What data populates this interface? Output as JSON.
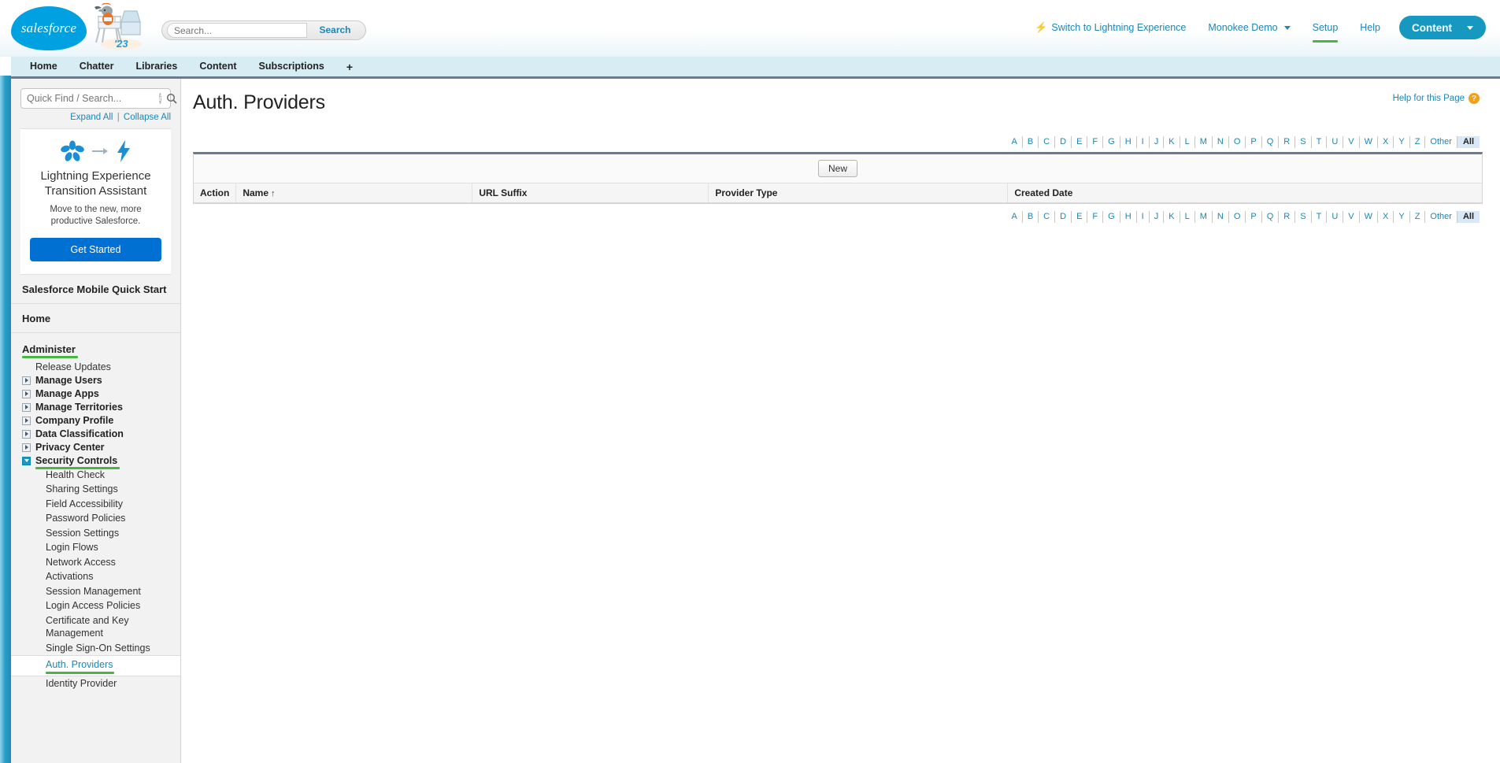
{
  "header": {
    "logo_text": "salesforce",
    "mascot_badge": "'23",
    "search": {
      "placeholder": "Search...",
      "value": "",
      "button_label": "Search"
    },
    "links": [
      {
        "label": "Switch to Lightning Experience",
        "icon": "lightning-bolt-icon",
        "active": false
      },
      {
        "label": "Monokee Demo",
        "icon": "chevron-down-icon",
        "active": false
      },
      {
        "label": "Setup",
        "active": true
      },
      {
        "label": "Help",
        "active": false
      }
    ],
    "app_button": {
      "label": "Content",
      "icon": "chevron-down-icon"
    }
  },
  "tabs": [
    {
      "label": "Home"
    },
    {
      "label": "Chatter"
    },
    {
      "label": "Libraries"
    },
    {
      "label": "Content"
    },
    {
      "label": "Subscriptions"
    },
    {
      "label": "+"
    }
  ],
  "sidebar": {
    "quick_find": {
      "placeholder": "Quick Find / Search...",
      "value": ""
    },
    "expand_all": "Expand All",
    "expand_sep": "|",
    "collapse_all": "Collapse All",
    "lex_card": {
      "title": "Lightning Experience Transition Assistant",
      "subtitle": "Move to the new, more productive Salesforce.",
      "button_label": "Get Started"
    },
    "mobile_quick_start": "Salesforce Mobile Quick Start",
    "home": "Home",
    "administer_label": "Administer",
    "nodes": [
      {
        "label": "Release Updates",
        "arrow": "none"
      },
      {
        "label": "Manage Users",
        "arrow": "collapsed"
      },
      {
        "label": "Manage Apps",
        "arrow": "collapsed"
      },
      {
        "label": "Manage Territories",
        "arrow": "collapsed"
      },
      {
        "label": "Company Profile",
        "arrow": "collapsed"
      },
      {
        "label": "Data Classification",
        "arrow": "collapsed"
      },
      {
        "label": "Privacy Center",
        "arrow": "collapsed"
      },
      {
        "label": "Security Controls",
        "arrow": "expanded",
        "underline": true
      }
    ],
    "security_children": [
      {
        "label": "Health Check",
        "selected": false
      },
      {
        "label": "Sharing Settings",
        "selected": false
      },
      {
        "label": "Field Accessibility",
        "selected": false
      },
      {
        "label": "Password Policies",
        "selected": false
      },
      {
        "label": "Session Settings",
        "selected": false
      },
      {
        "label": "Login Flows",
        "selected": false
      },
      {
        "label": "Network Access",
        "selected": false
      },
      {
        "label": "Activations",
        "selected": false
      },
      {
        "label": "Session Management",
        "selected": false
      },
      {
        "label": "Login Access Policies",
        "selected": false
      },
      {
        "label": "Certificate and Key Management",
        "selected": false
      },
      {
        "label": "Single Sign-On Settings",
        "selected": false
      },
      {
        "label": "Auth. Providers",
        "selected": true
      },
      {
        "label": "Identity Provider",
        "selected": false
      }
    ]
  },
  "main": {
    "page_title": "Auth. Providers",
    "help_link": "Help for this Page",
    "alphabet": [
      "A",
      "B",
      "C",
      "D",
      "E",
      "F",
      "G",
      "H",
      "I",
      "J",
      "K",
      "L",
      "M",
      "N",
      "O",
      "P",
      "Q",
      "R",
      "S",
      "T",
      "U",
      "V",
      "W",
      "X",
      "Y",
      "Z"
    ],
    "alpha_other": "Other",
    "alpha_all": "All",
    "alpha_selected": "All",
    "new_button": "New",
    "columns": [
      {
        "label": "Action",
        "sorted": false
      },
      {
        "label": "Name",
        "sorted": true,
        "sort_dir": "↑"
      },
      {
        "label": "URL Suffix",
        "sorted": false
      },
      {
        "label": "Provider Type",
        "sorted": false
      },
      {
        "label": "Created Date",
        "sorted": false
      }
    ],
    "rows": []
  },
  "colors": {
    "brand_blue": "#00a1e0",
    "accent_teal": "#1798c1",
    "link_blue": "#1c86b5",
    "active_green": "#4bb543",
    "lex_button_blue": "#0070d2",
    "help_orange": "#f0a01e",
    "tab_bg": "#d8ecf3",
    "rule_slate": "#6b7a93"
  }
}
